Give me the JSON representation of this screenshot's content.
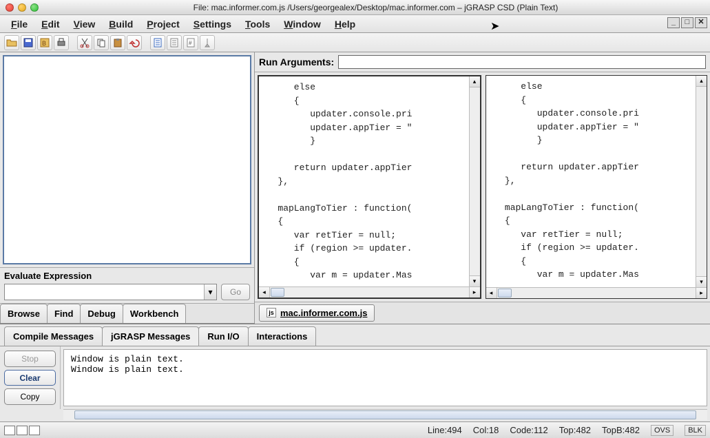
{
  "window": {
    "title": "File: mac.informer.com.js  /Users/georgealex/Desktop/mac.informer.com – jGRASP CSD (Plain Text)"
  },
  "menu": {
    "file": "File",
    "edit": "Edit",
    "view": "View",
    "build": "Build",
    "project": "Project",
    "settings": "Settings",
    "tools": "Tools",
    "window": "Window",
    "help": "Help"
  },
  "left": {
    "eval_label": "Evaluate Expression",
    "eval_value": "",
    "go": "Go",
    "tabs": {
      "browse": "Browse",
      "find": "Find",
      "debug": "Debug",
      "workbench": "Workbench"
    }
  },
  "editor": {
    "runargs_label": "Run Arguments:",
    "runargs_value": "",
    "file_tab": "mac.informer.com.js",
    "code": "      else\n      {\n         updater.console.pri\n         updater.appTier = \"\n         }\n\n      return updater.appTier\n   },\n\n   mapLangToTier : function(\n   {\n      var retTier = null;\n      if (region >= updater.\n      {\n         var m = updater.Mas"
  },
  "messages": {
    "tabs": {
      "compile": "Compile Messages",
      "jgrasp": "jGRASP Messages",
      "runio": "Run I/O",
      "interactions": "Interactions"
    },
    "btn_stop": "Stop",
    "btn_clear": "Clear",
    "btn_copy": "Copy",
    "text": "Window is plain text.\nWindow is plain text."
  },
  "status": {
    "line": "Line:494",
    "col": "Col:18",
    "code": "Code:112",
    "top": "Top:482",
    "topb": "TopB:482",
    "ovs": "OVS",
    "blk": "BLK"
  }
}
